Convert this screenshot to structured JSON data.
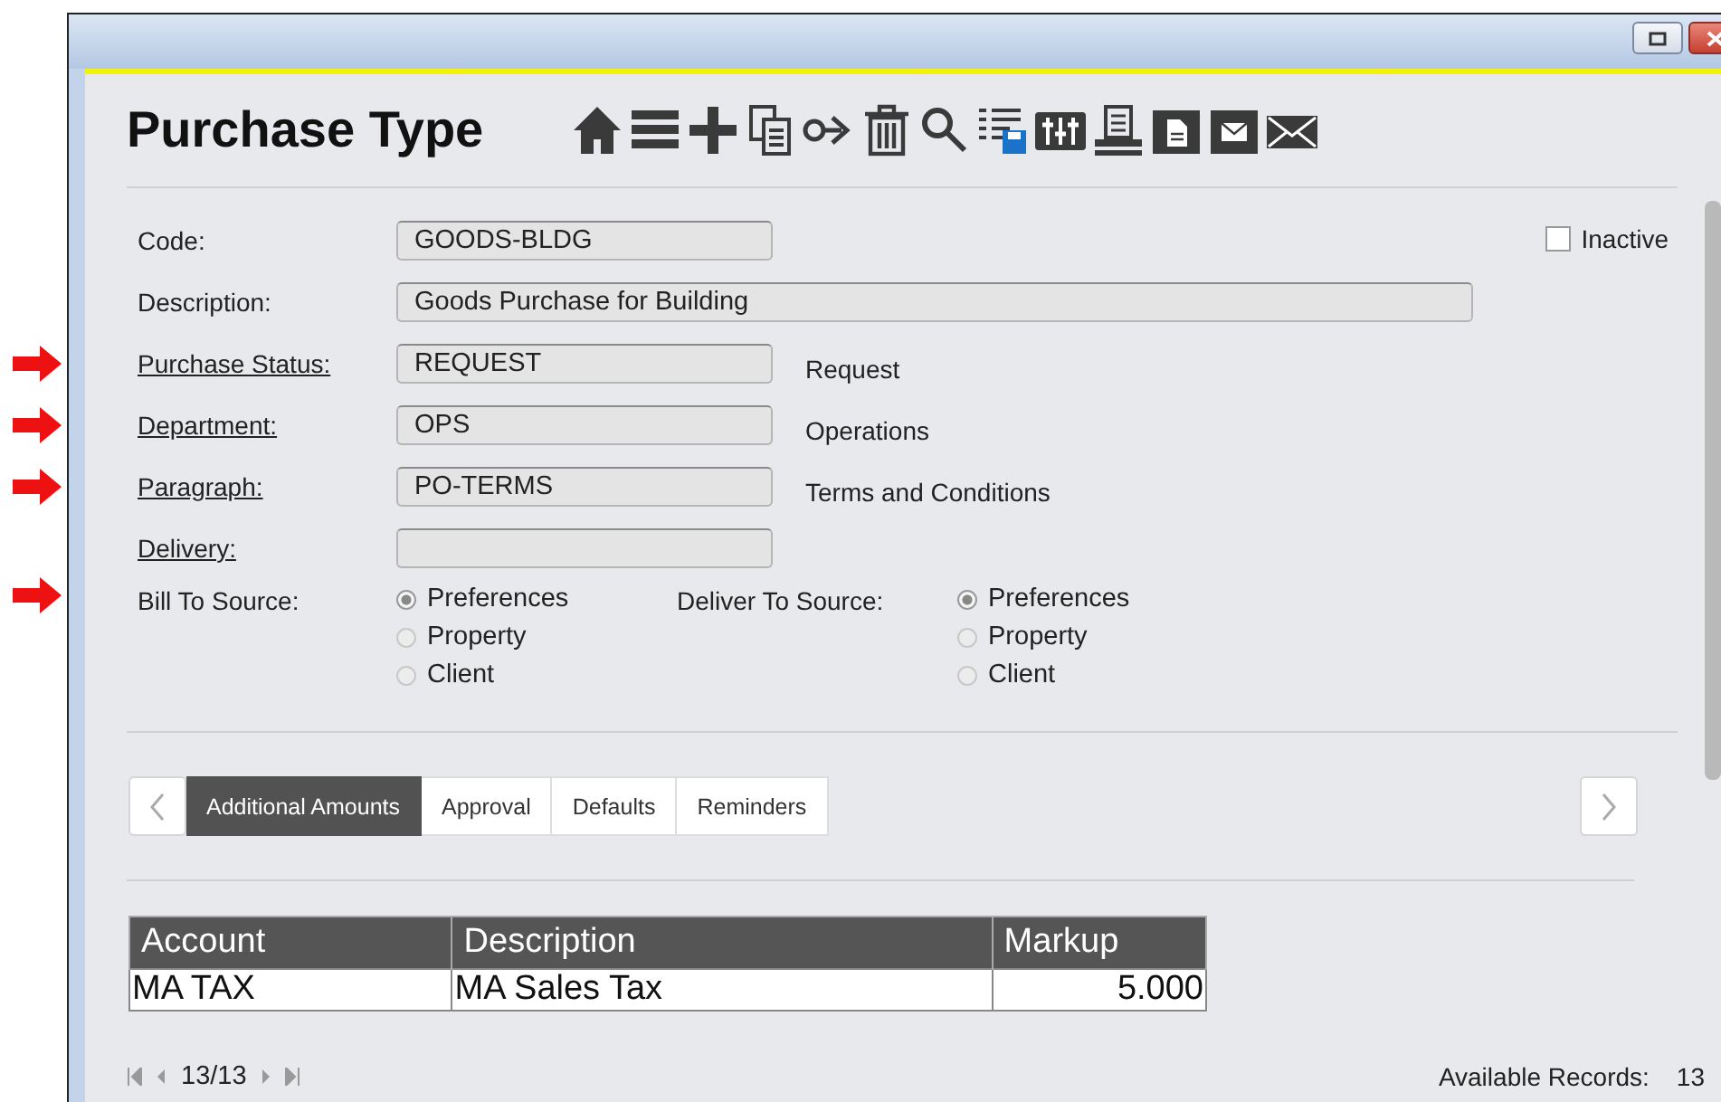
{
  "window": {
    "title": "Purchase Type"
  },
  "fields": [
    {
      "label": "Code:",
      "link": false,
      "marked": false,
      "value": "GOODS-BLDG",
      "kind": "short"
    },
    {
      "label": "Description:",
      "link": false,
      "marked": false,
      "value": "Goods Purchase for Building",
      "kind": "long"
    },
    {
      "label": "Purchase Status:",
      "link": true,
      "marked": true,
      "value": "REQUEST",
      "kind": "short",
      "note": "Request"
    },
    {
      "label": "Department:",
      "link": true,
      "marked": true,
      "value": "OPS",
      "kind": "short",
      "note": "Operations"
    },
    {
      "label": "Paragraph:",
      "link": true,
      "marked": true,
      "value": "PO-TERMS",
      "kind": "short",
      "note": "Terms and Conditions"
    },
    {
      "label": "Delivery:",
      "link": true,
      "marked": false,
      "kind": "short"
    }
  ],
  "inactive": {
    "label": "Inactive",
    "checked": false
  },
  "sources": {
    "marked": true,
    "groups": [
      {
        "label": "Bill To Source:",
        "options": [
          {
            "label": "Preferences",
            "selected": true
          },
          {
            "label": "Property",
            "selected": false
          },
          {
            "label": "Client",
            "selected": false
          }
        ]
      },
      {
        "label": "Deliver To Source:",
        "options": [
          {
            "label": "Preferences",
            "selected": true
          },
          {
            "label": "Property",
            "selected": false
          },
          {
            "label": "Client",
            "selected": false
          }
        ]
      }
    ]
  },
  "tabs": [
    {
      "label": "Additional Amounts",
      "selected": true
    },
    {
      "label": "Approval",
      "selected": false
    },
    {
      "label": "Defaults",
      "selected": false
    },
    {
      "label": "Reminders",
      "selected": false
    }
  ],
  "table": {
    "columns": [
      "Account",
      "Description",
      "Markup"
    ],
    "rows": [
      [
        "MA TAX",
        "MA Sales Tax",
        "5.000"
      ]
    ]
  },
  "status_bar": {
    "position": "13/13",
    "records_label": "Available Records:",
    "records": "13"
  }
}
